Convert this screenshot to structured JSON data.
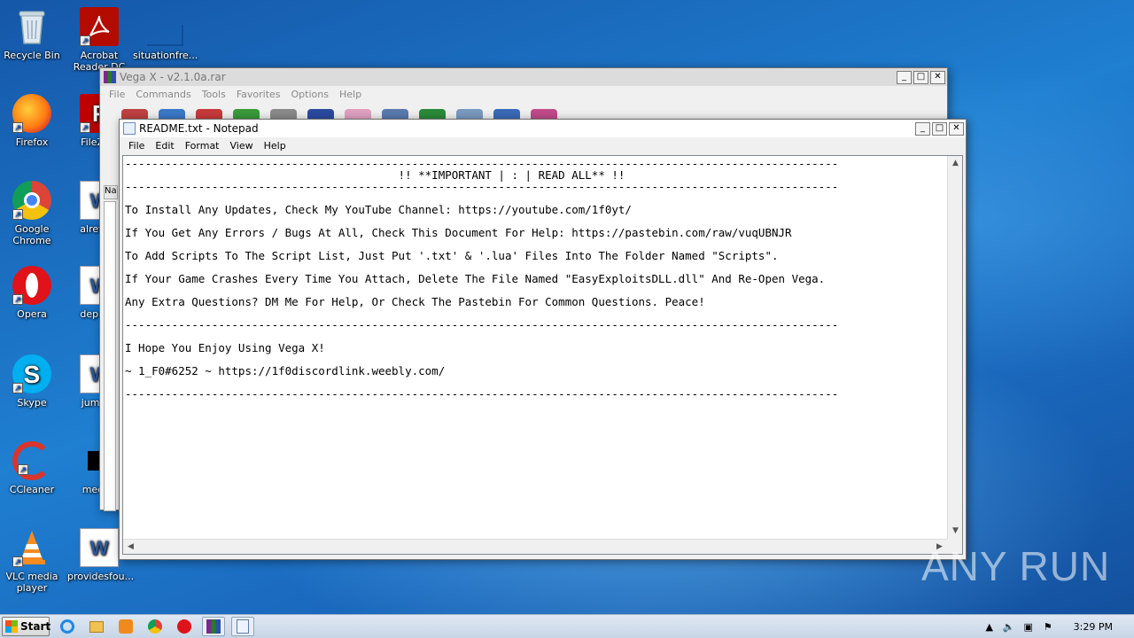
{
  "desktop": {
    "icons": [
      {
        "label": "Recycle Bin"
      },
      {
        "label": "Acrobat Reader DC"
      },
      {
        "label": "situationfre..."
      },
      {
        "label": "Firefox"
      },
      {
        "label": "FileZilla"
      },
      {
        "label": "Google Chrome"
      },
      {
        "label": "alreturn"
      },
      {
        "label": "Opera"
      },
      {
        "label": "departn"
      },
      {
        "label": "Skype"
      },
      {
        "label": "jumpco"
      },
      {
        "label": "CCleaner"
      },
      {
        "label": "meetin"
      },
      {
        "label": "VLC media player"
      },
      {
        "label": "providesfou..."
      }
    ]
  },
  "winrar": {
    "title": "Vega X - v2.1.0a.rar",
    "menu": [
      "File",
      "Commands",
      "Tools",
      "Favorites",
      "Options",
      "Help"
    ],
    "column_header": "Na"
  },
  "notepad": {
    "title": "README.txt - Notepad",
    "menu": [
      "File",
      "Edit",
      "Format",
      "View",
      "Help"
    ],
    "lines": [
      "-----------------------------------------------------------------------------------------------------------",
      "                                         !! **IMPORTANT | : | READ ALL** !!",
      "-----------------------------------------------------------------------------------------------------------",
      "",
      "To Install Any Updates, Check My YouTube Channel: https://youtube.com/1f0yt/",
      "",
      "If You Get Any Errors / Bugs At All, Check This Document For Help: https://pastebin.com/raw/vuqUBNJR",
      "",
      "To Add Scripts To The Script List, Just Put '.txt' & '.lua' Files Into The Folder Named \"Scripts\".",
      "",
      "If Your Game Crashes Every Time You Attach, Delete The File Named \"EasyExploitsDLL.dll\" And Re-Open Vega.",
      "",
      "Any Extra Questions? DM Me For Help, Or Check The Pastebin For Common Questions. Peace!",
      "",
      "-----------------------------------------------------------------------------------------------------------",
      "",
      "I Hope You Enjoy Using Vega X!",
      "",
      "~ 1_F0#6252 ~ https://1f0discordlink.weebly.com/",
      "",
      "-----------------------------------------------------------------------------------------------------------"
    ]
  },
  "taskbar": {
    "start_label": "Start",
    "clock": "3:29 PM"
  },
  "watermark": {
    "text": "ANY RUN"
  }
}
